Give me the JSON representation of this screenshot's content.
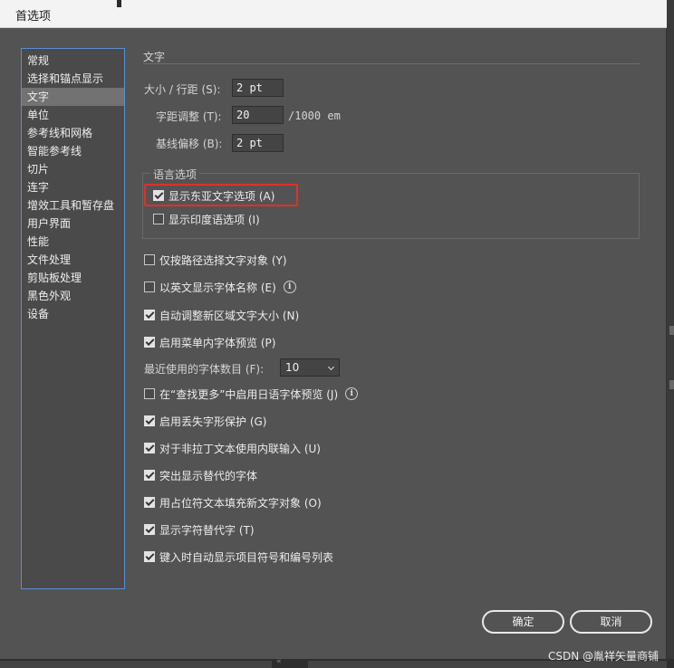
{
  "window": {
    "title": "首选项"
  },
  "sidebar": {
    "items": [
      {
        "label": "常规"
      },
      {
        "label": "选择和锚点显示"
      },
      {
        "label": "文字",
        "active": true
      },
      {
        "label": "单位"
      },
      {
        "label": "参考线和网格"
      },
      {
        "label": "智能参考线"
      },
      {
        "label": "切片"
      },
      {
        "label": "连字"
      },
      {
        "label": "增效工具和暂存盘"
      },
      {
        "label": "用户界面"
      },
      {
        "label": "性能"
      },
      {
        "label": "文件处理"
      },
      {
        "label": "剪贴板处理"
      },
      {
        "label": "黑色外观"
      },
      {
        "label": "设备"
      }
    ]
  },
  "type_section": {
    "title": "文字",
    "size_leading": {
      "label": "大小 / 行距 (S):",
      "value": "2 pt"
    },
    "tracking": {
      "label": "字距调整 (T):",
      "value": "20",
      "unit": "/1000 em"
    },
    "baseline_shift": {
      "label": "基线偏移 (B):",
      "value": "2 pt"
    }
  },
  "language_options": {
    "title": "语言选项",
    "show_east_asian": {
      "label": "显示东亚文字选项 (A)",
      "checked": true
    },
    "show_indic": {
      "label": "显示印度语选项 (I)",
      "checked": false
    }
  },
  "options": [
    {
      "label": "仅按路径选择文字对象 (Y)",
      "checked": false
    },
    {
      "label": "以英文显示字体名称 (E)",
      "checked": false,
      "info": true
    },
    {
      "label": "自动调整新区域文字大小 (N)",
      "checked": true
    },
    {
      "label": "启用菜单内字体预览 (P)",
      "checked": true
    }
  ],
  "recent_fonts": {
    "label": "最近使用的字体数目 (F):",
    "value": "10"
  },
  "options2": [
    {
      "label": "在“查找更多”中启用日语字体预览 (J)",
      "checked": false,
      "info": true
    },
    {
      "label": "启用丢失字形保护 (G)",
      "checked": true
    },
    {
      "label": "对于非拉丁文本使用内联输入 (U)",
      "checked": true
    },
    {
      "label": "突出显示替代的字体",
      "checked": true
    },
    {
      "label": "用占位符文本填充新文字对象 (O)",
      "checked": true
    },
    {
      "label": "显示字符替代字 (T)",
      "checked": true
    },
    {
      "label": "键入时自动显示项目符号和编号列表",
      "checked": true
    }
  ],
  "buttons": {
    "ok": "确定",
    "cancel": "取消"
  },
  "info_glyph": "i",
  "bottom_arrows": "«",
  "watermark": "CSDN @胤祥矢量商铺"
}
